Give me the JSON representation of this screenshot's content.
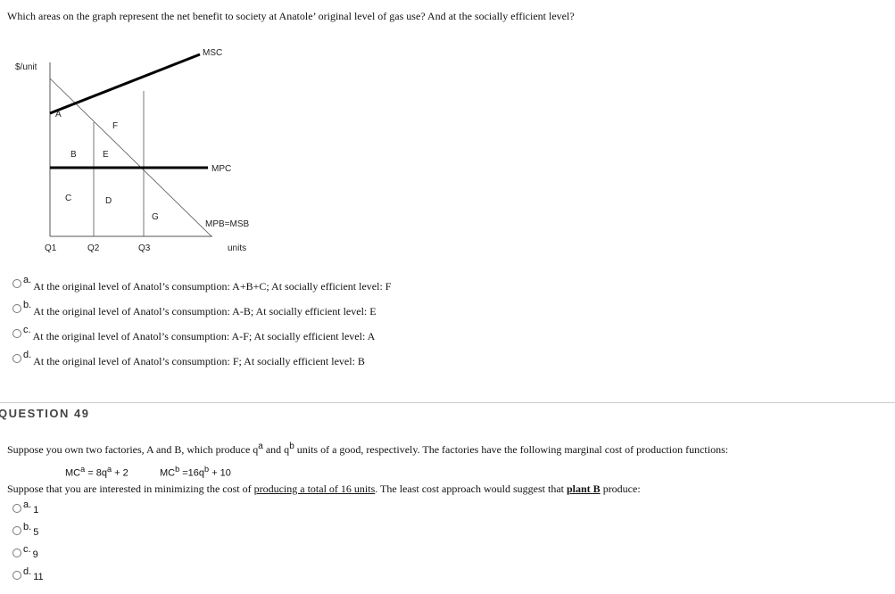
{
  "q48": {
    "prompt": "Which areas on the graph represent the net benefit to society at Anatole’ original level of gas use?  And at the socially efficient level?",
    "graph": {
      "y_label": "$/unit",
      "x_label": "units",
      "curves": [
        "MSC",
        "MPC",
        "MPB=MSB"
      ],
      "areas": [
        "A",
        "B",
        "C",
        "D",
        "E",
        "F",
        "G"
      ],
      "x_ticks": [
        "Q1",
        "Q2",
        "Q3"
      ]
    },
    "options": [
      {
        "letter": "a.",
        "text": "At the original level of Anatol’s consumption: A+B+C; At socially efficient level: F"
      },
      {
        "letter": "b.",
        "text": "At the original level of Anatol’s consumption: A-B; At socially efficient level: E"
      },
      {
        "letter": "c.",
        "text": "At the original level of Anatol’s consumption: A-F; At socially efficient level: A"
      },
      {
        "letter": "d.",
        "text": "At the original level of Anatol’s consumption: F; At socially efficient level: B"
      }
    ]
  },
  "q49": {
    "header": "QUESTION 49",
    "intro_1": "Suppose you own two factories, A and B, which produce q",
    "sup_a": "a",
    "intro_2": " and q",
    "sup_b": "b",
    "intro_3": " units of a good, respectively.  The factories have the following marginal cost of production functions:",
    "mca": {
      "pre": "MC",
      "sup1": "a",
      "mid": " = 8q",
      "sup2": "a",
      "post": " + 2"
    },
    "mcb": {
      "pre": "MC",
      "sup1": "b",
      "mid": " =16q",
      "sup2": "b",
      "post": " + 10"
    },
    "line2_1": "Suppose that you are interested in minimizing the cost of ",
    "line2_u": "producing a total of 16 units",
    "line2_2": ".  The least cost approach would suggest that ",
    "line2_b": "plant B",
    "line2_3": " produce:",
    "options": [
      {
        "letter": "a.",
        "text": "1"
      },
      {
        "letter": "b.",
        "text": "5"
      },
      {
        "letter": "c.",
        "text": "9"
      },
      {
        "letter": "d.",
        "text": "11"
      }
    ]
  }
}
